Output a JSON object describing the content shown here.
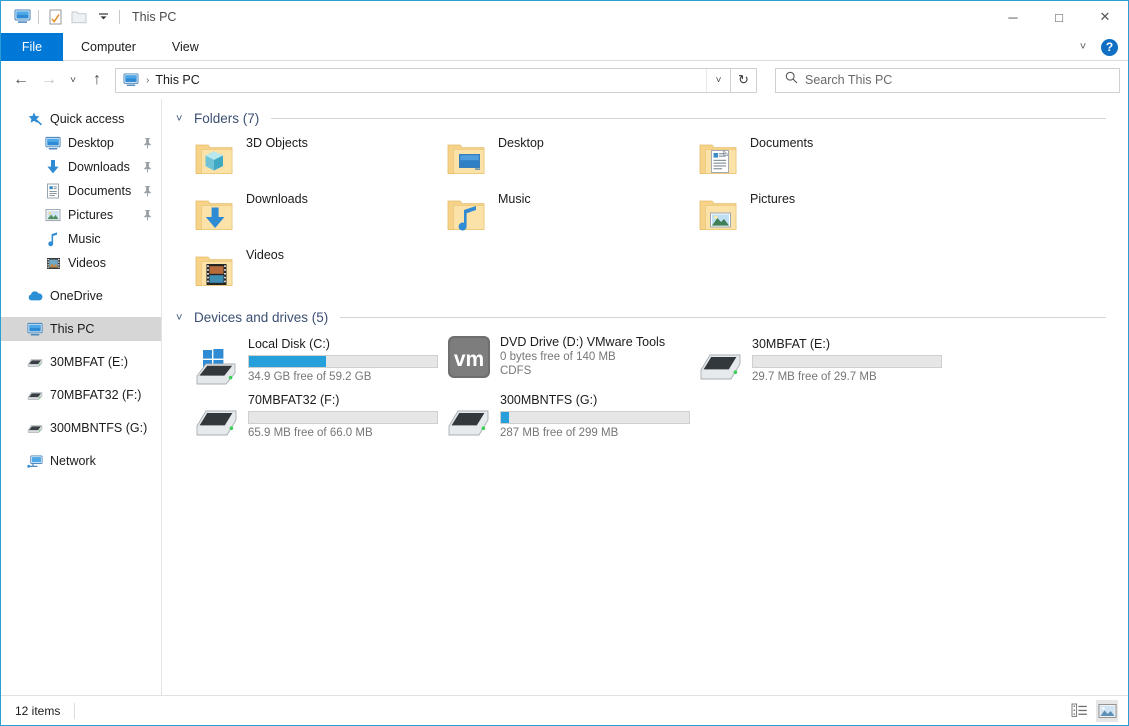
{
  "window": {
    "title": "This PC",
    "quick_access_icons": [
      "monitor-icon",
      "properties-icon",
      "new-folder-icon",
      "customize-chevron-icon"
    ],
    "controls": {
      "minimize": "─",
      "maximize": "□",
      "close": "✕"
    },
    "accent_color": "#0078d7",
    "border_color": "#2b9fd4"
  },
  "ribbon": {
    "tabs": [
      {
        "label": "File",
        "active_style": "file"
      },
      {
        "label": "Computer",
        "active_style": "normal"
      },
      {
        "label": "View",
        "active_style": "normal"
      }
    ],
    "expand_icon": "chevron-down-icon",
    "help_label": "?"
  },
  "navigation": {
    "back_icon": "←",
    "forward_icon": "→",
    "recent_icon": "˅",
    "up_icon": "↑",
    "address": {
      "icon": "this-pc-icon",
      "separator": "›",
      "path_label": "This PC",
      "dropdown_icon": "˅"
    },
    "refresh_icon": "↻",
    "search": {
      "placeholder": "Search This PC",
      "value": "",
      "icon": "search-icon"
    }
  },
  "sidebar": {
    "items": [
      {
        "label": "Quick access",
        "icon": "star-pin-icon",
        "indent": 0,
        "pinned": false,
        "selected": false
      },
      {
        "label": "Desktop",
        "icon": "desktop-icon",
        "indent": 1,
        "pinned": true,
        "selected": false
      },
      {
        "label": "Downloads",
        "icon": "downloads-icon",
        "indent": 1,
        "pinned": true,
        "selected": false
      },
      {
        "label": "Documents",
        "icon": "documents-icon",
        "indent": 1,
        "pinned": true,
        "selected": false
      },
      {
        "label": "Pictures",
        "icon": "pictures-icon",
        "indent": 1,
        "pinned": true,
        "selected": false
      },
      {
        "label": "Music",
        "icon": "music-icon",
        "indent": 1,
        "pinned": false,
        "selected": false
      },
      {
        "label": "Videos",
        "icon": "videos-icon",
        "indent": 1,
        "pinned": false,
        "selected": false
      },
      {
        "label": "OneDrive",
        "icon": "onedrive-icon",
        "indent": 0,
        "pinned": false,
        "selected": false,
        "gap_before": true
      },
      {
        "label": "This PC",
        "icon": "this-pc-icon",
        "indent": 0,
        "pinned": false,
        "selected": true,
        "gap_before": true
      },
      {
        "label": "30MBFAT (E:)",
        "icon": "drive-icon",
        "indent": 0,
        "pinned": false,
        "selected": false,
        "gap_before": true
      },
      {
        "label": "70MBFAT32 (F:)",
        "icon": "drive-icon",
        "indent": 0,
        "pinned": false,
        "selected": false,
        "gap_before": true
      },
      {
        "label": "300MBNTFS (G:)",
        "icon": "drive-icon",
        "indent": 0,
        "pinned": false,
        "selected": false,
        "gap_before": true
      },
      {
        "label": "Network",
        "icon": "network-icon",
        "indent": 0,
        "pinned": false,
        "selected": false,
        "gap_before": true
      }
    ]
  },
  "content": {
    "folders_group": {
      "chevron": "˅",
      "title": "Folders (7)",
      "items": [
        {
          "label": "3D Objects",
          "icon": "folder-3d-objects-icon"
        },
        {
          "label": "Desktop",
          "icon": "folder-desktop-icon"
        },
        {
          "label": "Documents",
          "icon": "folder-documents-icon"
        },
        {
          "label": "Downloads",
          "icon": "folder-downloads-icon"
        },
        {
          "label": "Music",
          "icon": "folder-music-icon"
        },
        {
          "label": "Pictures",
          "icon": "folder-pictures-icon"
        },
        {
          "label": "Videos",
          "icon": "folder-videos-icon"
        }
      ]
    },
    "devices_group": {
      "chevron": "˅",
      "title": "Devices and drives (5)",
      "items": [
        {
          "name": "Local Disk (C:)",
          "icon": "windows-drive-icon",
          "has_bar": true,
          "fill_percent": 41,
          "bar_color": "#26a0da",
          "sub1": "34.9 GB free of 59.2 GB",
          "sub2": ""
        },
        {
          "name": "DVD Drive (D:) VMware Tools",
          "icon": "vmware-dvd-icon",
          "has_bar": false,
          "fill_percent": 0,
          "bar_color": "",
          "sub1": "0 bytes free of 140 MB",
          "sub2": "CDFS"
        },
        {
          "name": "30MBFAT (E:)",
          "icon": "removable-drive-icon",
          "has_bar": true,
          "fill_percent": 0,
          "bar_color": "#26a0da",
          "sub1": "29.7 MB free of 29.7 MB",
          "sub2": ""
        },
        {
          "name": "70MBFAT32 (F:)",
          "icon": "removable-drive-icon",
          "has_bar": true,
          "fill_percent": 0,
          "bar_color": "#26a0da",
          "sub1": "65.9 MB free of 66.0 MB",
          "sub2": ""
        },
        {
          "name": "300MBNTFS (G:)",
          "icon": "removable-drive-icon",
          "has_bar": true,
          "fill_percent": 4,
          "bar_color": "#26a0da",
          "sub1": "287 MB free of 299 MB",
          "sub2": ""
        }
      ]
    }
  },
  "statusbar": {
    "item_count": "12 items",
    "views": [
      {
        "icon": "details-view-icon",
        "active": false
      },
      {
        "icon": "large-icons-view-icon",
        "active": true
      }
    ]
  }
}
